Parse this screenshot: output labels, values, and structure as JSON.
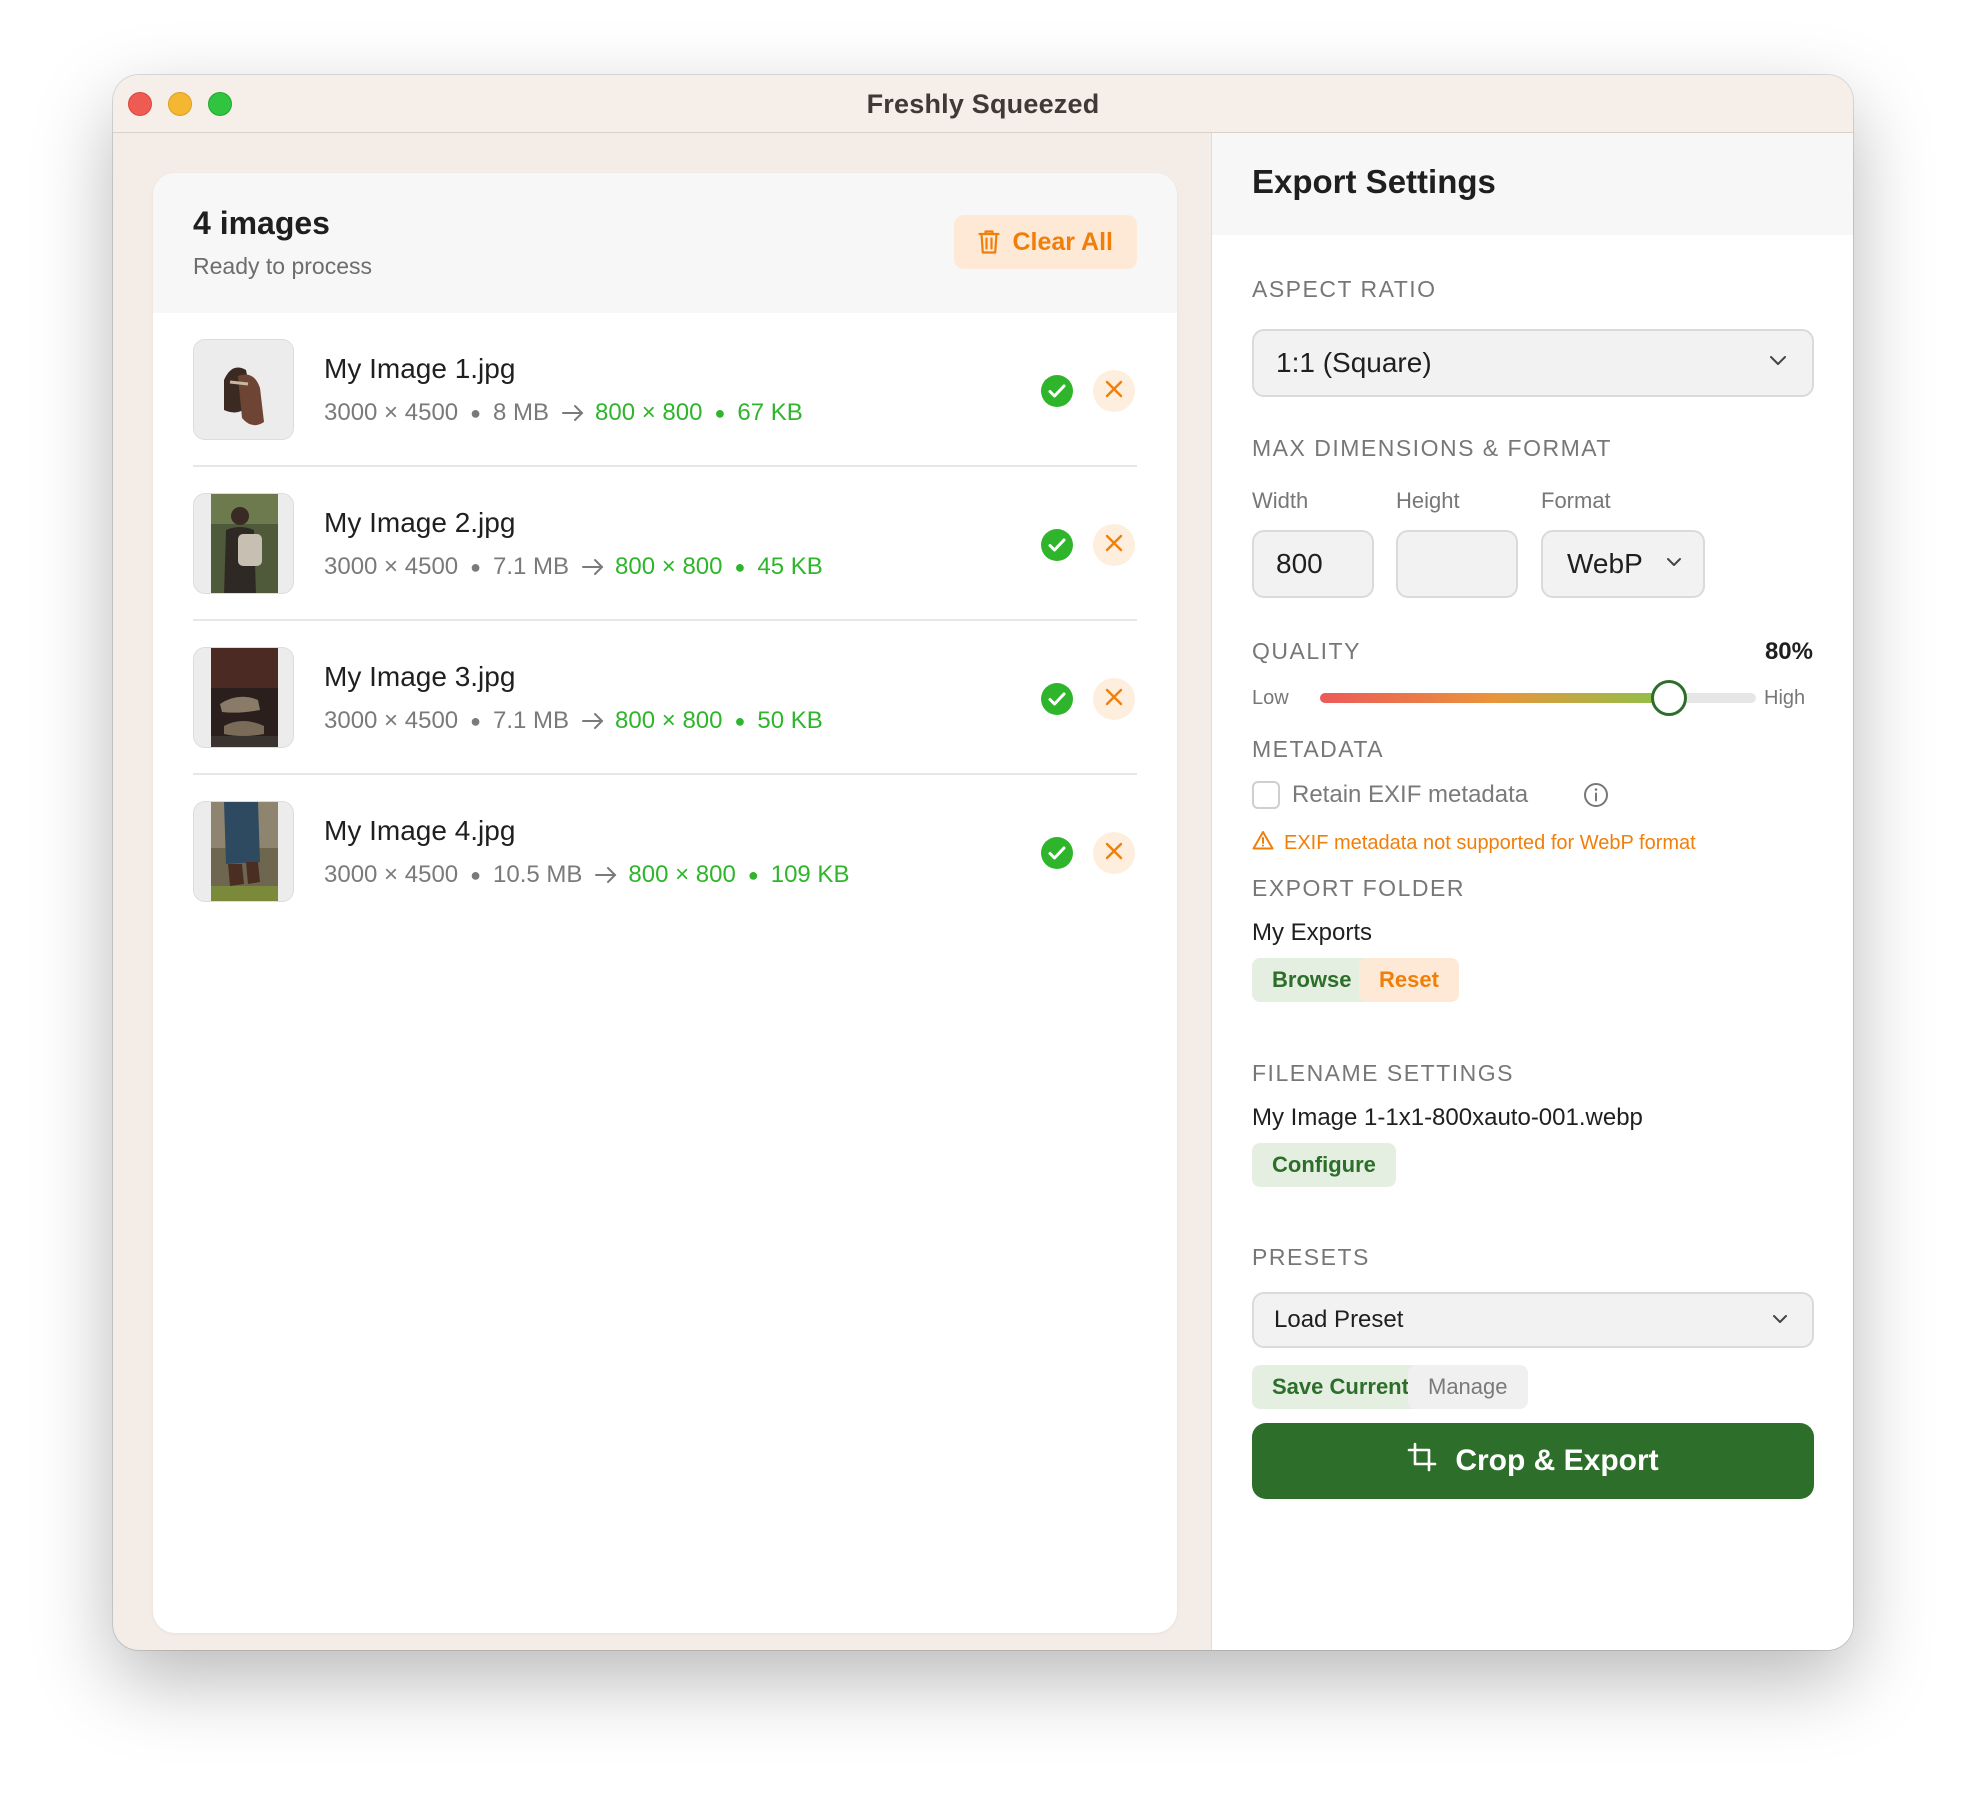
{
  "window": {
    "title": "Freshly Squeezed"
  },
  "images": {
    "count_label": "4 images",
    "status": "Ready to process",
    "clear_all_label": "Clear All",
    "items": [
      {
        "name": "My Image 1.jpg",
        "orig_dims": "3000 × 4500",
        "orig_size": "8 MB",
        "new_dims": "800 × 800",
        "new_size": "67 KB"
      },
      {
        "name": "My Image 2.jpg",
        "orig_dims": "3000 × 4500",
        "orig_size": "7.1 MB",
        "new_dims": "800 × 800",
        "new_size": "45 KB"
      },
      {
        "name": "My Image 3.jpg",
        "orig_dims": "3000 × 4500",
        "orig_size": "7.1 MB",
        "new_dims": "800 × 800",
        "new_size": "50 KB"
      },
      {
        "name": "My Image 4.jpg",
        "orig_dims": "3000 × 4500",
        "orig_size": "10.5 MB",
        "new_dims": "800 × 800",
        "new_size": "109 KB"
      }
    ]
  },
  "settings": {
    "title": "Export Settings",
    "aspect_ratio": {
      "heading": "ASPECT RATIO",
      "value": "1:1 (Square)"
    },
    "dimensions": {
      "heading": "MAX DIMENSIONS & FORMAT",
      "width_label": "Width",
      "width_value": "800",
      "height_label": "Height",
      "height_value": "",
      "format_label": "Format",
      "format_value": "WebP"
    },
    "quality": {
      "heading": "QUALITY",
      "value_label": "80%",
      "value_fraction": 0.8,
      "low_label": "Low",
      "high_label": "High"
    },
    "metadata": {
      "heading": "METADATA",
      "retain_label": "Retain EXIF metadata",
      "retain_checked": false,
      "warning": "EXIF metadata not supported for WebP format"
    },
    "export_folder": {
      "heading": "EXPORT FOLDER",
      "folder_name": "My Exports",
      "browse_label": "Browse",
      "reset_label": "Reset"
    },
    "filename": {
      "heading": "FILENAME SETTINGS",
      "example": "My Image 1-1x1-800xauto-001.webp",
      "configure_label": "Configure"
    },
    "presets": {
      "heading": "PRESETS",
      "select_value": "Load Preset",
      "save_label": "Save Current",
      "manage_label": "Manage"
    },
    "export_label": "Crop & Export"
  },
  "colors": {
    "accent_green": "#2c6e2a",
    "success_green": "#2fb52b",
    "warning_orange": "#f07f0a"
  }
}
